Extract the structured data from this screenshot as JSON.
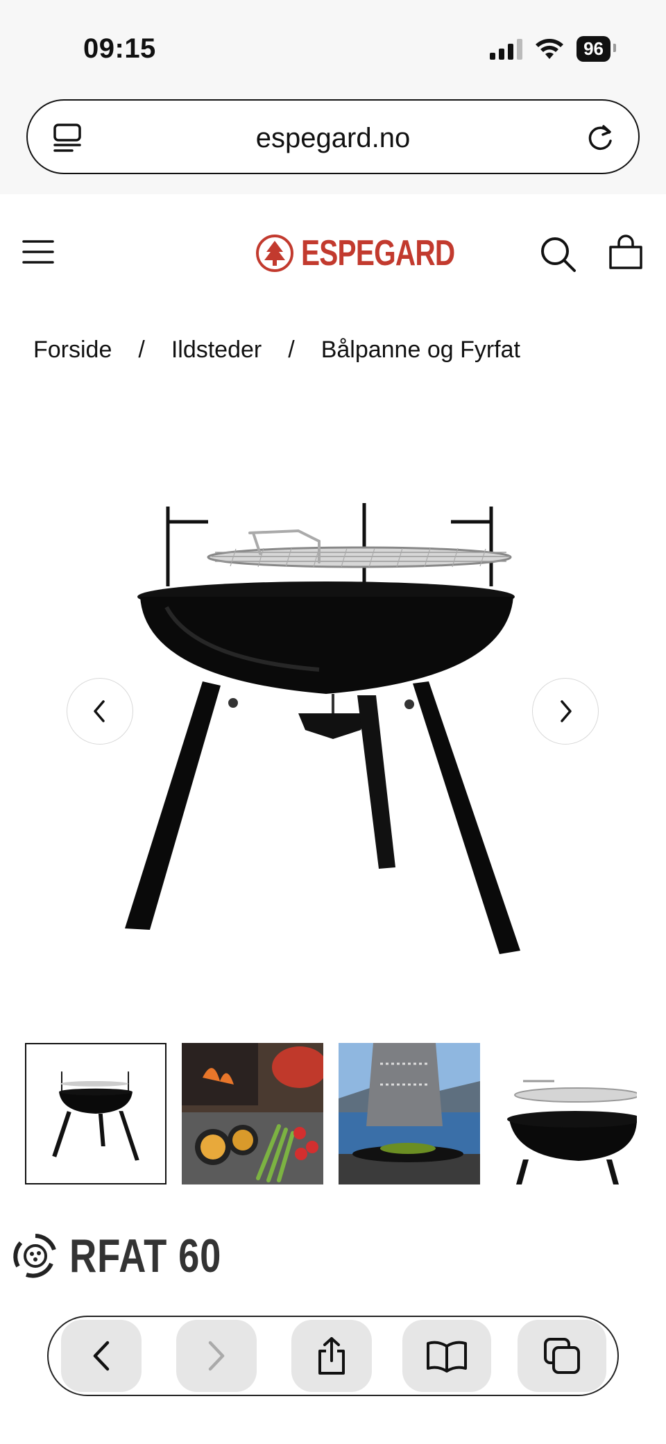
{
  "status": {
    "time": "09:15",
    "battery": "96"
  },
  "browser": {
    "url": "espegard.no"
  },
  "site": {
    "logo_text": "ESPEGARD",
    "brand_color": "#c23a2e"
  },
  "breadcrumb": {
    "items": [
      "Forside",
      "Ildsteder",
      "Bålpanne og Fyrfat"
    ],
    "separator": "/"
  },
  "product": {
    "title_visible": "RFAT 60"
  },
  "icons": {
    "status": [
      "signal-icon",
      "wifi-icon",
      "battery-icon"
    ],
    "browser": [
      "tabs-overview-icon",
      "reload-icon"
    ],
    "header": [
      "menu-icon",
      "search-icon",
      "cart-icon"
    ],
    "carousel": [
      "chevron-left-icon",
      "chevron-right-icon"
    ],
    "toolbar": [
      "back-arrow-icon",
      "forward-arrow-icon",
      "share-icon",
      "bookmarks-icon",
      "tabs-icon"
    ]
  }
}
